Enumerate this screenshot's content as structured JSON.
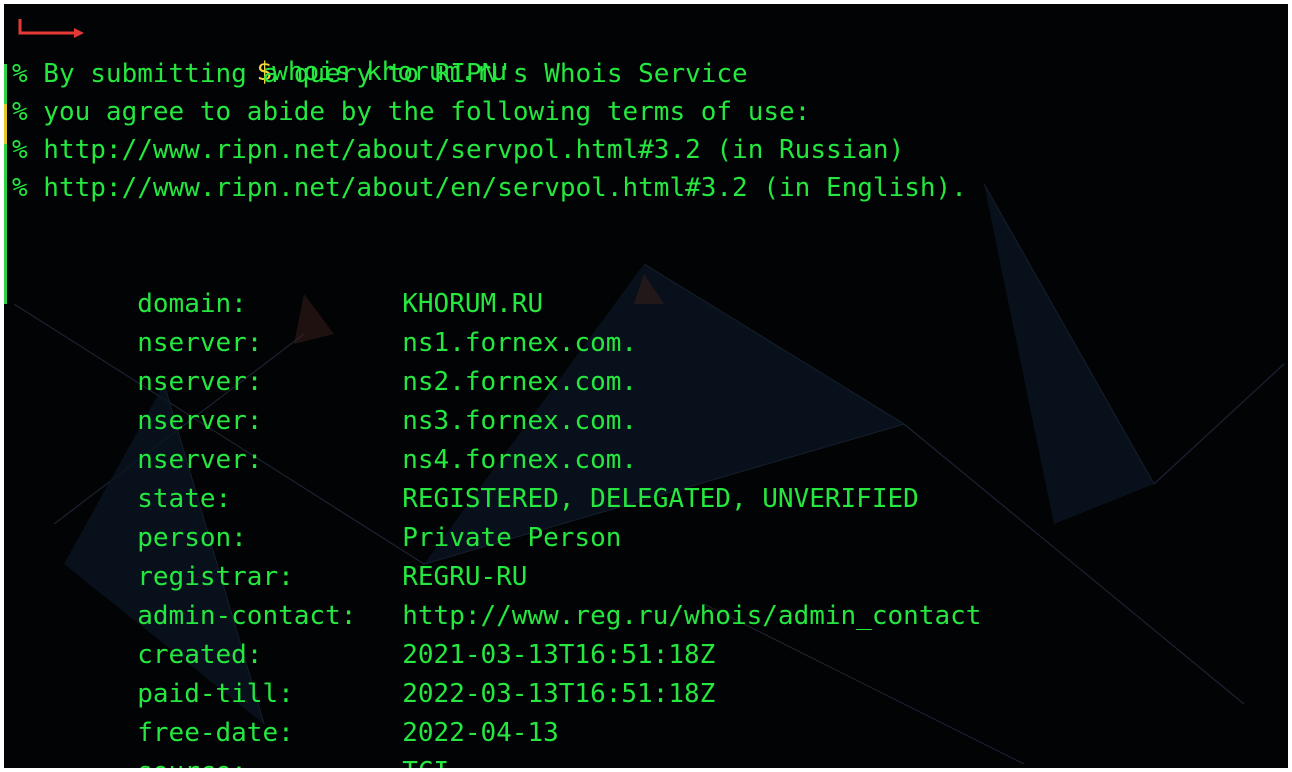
{
  "terminal": {
    "command": {
      "dollar": "$",
      "text": "whois khorum.ru"
    },
    "notice_lines": [
      "% By submitting a query to RIPN's Whois Service",
      "% you agree to abide by the following terms of use:",
      "% http://www.ripn.net/about/servpol.html#3.2 (in Russian)",
      "% http://www.ripn.net/about/en/servpol.html#3.2 (in English)."
    ],
    "records": [
      {
        "key": "domain:",
        "value": "KHORUM.RU"
      },
      {
        "key": "nserver:",
        "value": "ns1.fornex.com."
      },
      {
        "key": "nserver:",
        "value": "ns2.fornex.com."
      },
      {
        "key": "nserver:",
        "value": "ns3.fornex.com."
      },
      {
        "key": "nserver:",
        "value": "ns4.fornex.com."
      },
      {
        "key": "state:",
        "value": "REGISTERED, DELEGATED, UNVERIFIED"
      },
      {
        "key": "person:",
        "value": "Private Person"
      },
      {
        "key": "registrar:",
        "value": "REGRU-RU"
      },
      {
        "key": "admin-contact:",
        "value": "http://www.reg.ru/whois/admin_contact"
      },
      {
        "key": "created:",
        "value": "2021-03-13T16:51:18Z"
      },
      {
        "key": "paid-till:",
        "value": "2022-03-13T16:51:18Z"
      },
      {
        "key": "free-date:",
        "value": "2022-04-13"
      },
      {
        "key": "source:",
        "value": "TCI"
      }
    ]
  },
  "colors": {
    "background": "#020305",
    "text": "#25e73f",
    "prompt_arrow": "#e53935",
    "dollar": "#f2d43c"
  },
  "icons": {
    "prompt": "prompt-arrow-icon"
  }
}
